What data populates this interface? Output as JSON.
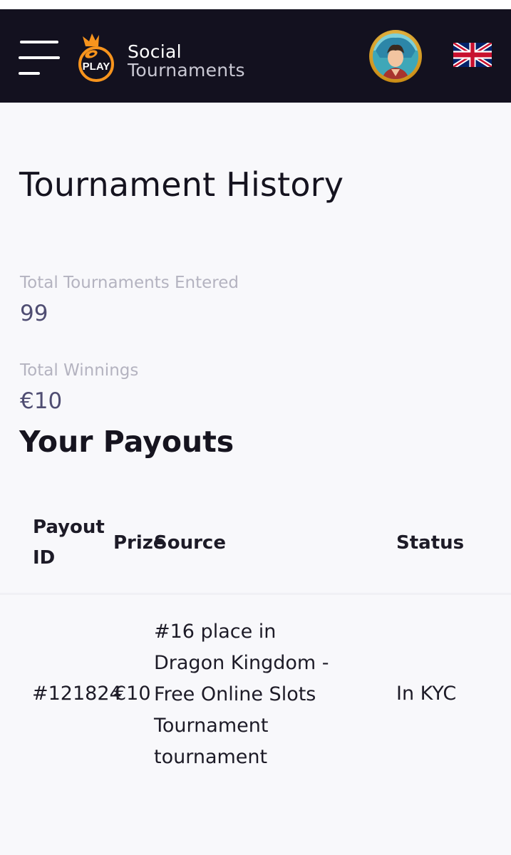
{
  "header": {
    "menu_icon": "hamburger-menu-icon",
    "logo_text": "PLAY",
    "brand_line1": "Social",
    "brand_line2": "Tournaments",
    "avatar_icon": "user-avatar",
    "language_icon": "uk-flag-icon"
  },
  "page": {
    "title": "Tournament History"
  },
  "stats": {
    "total_entered_label": "Total Tournaments Entered",
    "total_entered_value": "99",
    "total_winnings_label": "Total Winnings",
    "total_winnings_value": "€10"
  },
  "payouts": {
    "title": "Your Payouts",
    "columns": {
      "payout_id_line1": "Payout",
      "payout_id_line2": "ID",
      "prize": "Prize",
      "source": "Source",
      "status": "Status"
    },
    "rows": [
      {
        "payout_id": "#121824",
        "prize": "€10",
        "source_lines": [
          "#16 place in",
          "Dragon Kingdom -",
          "Free Online Slots",
          "Tournament",
          "tournament"
        ],
        "status": "In KYC"
      }
    ]
  },
  "colors": {
    "header_bg": "#13111f",
    "page_bg": "#f8f8fb",
    "accent_orange": "#f7941d",
    "muted_label": "#b4b3c0",
    "stat_value": "#4f4d72"
  }
}
